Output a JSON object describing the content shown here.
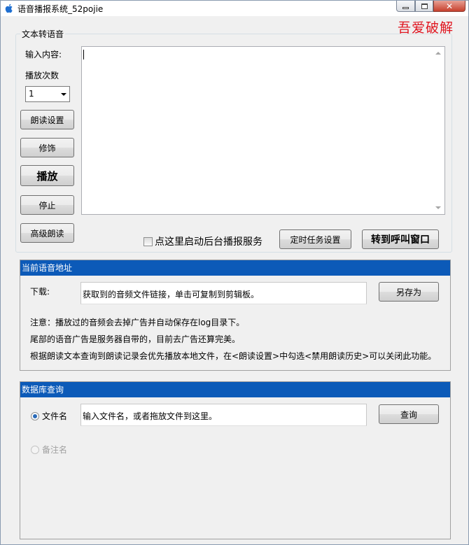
{
  "window": {
    "title": "语音播报系统_52pojie",
    "minimize_icon": "minimize-icon",
    "maximize_icon": "maximize-icon",
    "close_icon": "close-icon",
    "close_glyph": "✕"
  },
  "watermark": "吾爱破解",
  "tts_group": {
    "title": "文本转语音",
    "input_label": "输入内容:",
    "play_count_label": "播放次数",
    "play_count_value": "1",
    "text_value": "",
    "buttons": {
      "read_settings": "朗读设置",
      "decorate": "修饰",
      "play": "播放",
      "stop": "停止",
      "advanced_read": "高级朗读",
      "scheduled_tasks": "定时任务设置",
      "goto_call_window": "转到呼叫窗口"
    },
    "background_service_checkbox": {
      "label": "点这里启动后台播报服务",
      "checked": false
    }
  },
  "audio_url_panel": {
    "header": "当前语音地址",
    "download_label": "下载:",
    "download_value": "获取到的音频文件链接，单击可复制到剪辑板。",
    "save_as_button": "另存为",
    "notes": [
      "注意：播放过的音频会去掉广告并自动保存在log目录下。",
      "尾部的语音广告是服务器自带的，目前去广告还算完美。",
      "根据朗读文本查询到朗读记录会优先播放本地文件，在<朗读设置>中勾选<禁用朗读历史>可以关闭此功能。"
    ]
  },
  "db_query_panel": {
    "header": "数据库查询",
    "filename_radio": {
      "label": "文件名",
      "selected": true
    },
    "filename_input_placeholder": "输入文件名，或者拖放文件到这里。",
    "query_button": "查询",
    "remark_radio": {
      "label": "备注名",
      "selected": false,
      "disabled": true
    }
  },
  "colors": {
    "panel_header_bg": "#0c5ab8",
    "watermark": "#e0141e"
  }
}
